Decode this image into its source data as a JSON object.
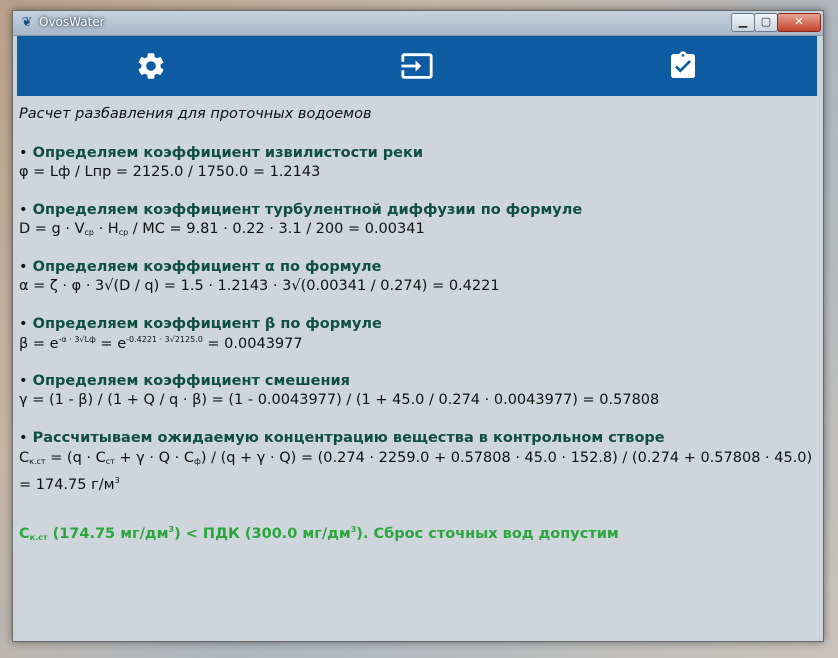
{
  "window": {
    "title": "OvosWater",
    "minimize_glyph": "▁",
    "maximize_glyph": "▢",
    "close_glyph": "✕"
  },
  "toolbar": {
    "items": [
      {
        "icon": "gear-icon"
      },
      {
        "icon": "exit-icon"
      },
      {
        "icon": "clipboard-check-icon"
      }
    ],
    "background": "#0d5ba1"
  },
  "content": {
    "title": "Расчет разбавления для проточных водоемов",
    "sections": [
      {
        "heading": "Определяем коэффициент извилистости реки",
        "formula": "φ = Lф / Lпр = 2125.0 / 1750.0 = 1.2143"
      },
      {
        "heading": "Определяем коэффициент турбулентной диффузии по формуле",
        "formula_parts": {
          "p1": "D = g · V",
          "s1": "ср",
          "p2": " · H",
          "s2": "ср",
          "p3": " / MC = 9.81 · 0.22 · 3.1 / 200 = 0.00341"
        }
      },
      {
        "heading": "Определяем коэффициент α по формуле",
        "formula": "α = ζ · φ · 3√(D / q) = 1.5 · 1.2143 · 3√(0.00341 / 0.274) = 0.4221"
      },
      {
        "heading": "Определяем коэффициент β по формуле",
        "formula_parts": {
          "p1": "β = e",
          "sup1": "-α · 3√Lф",
          "p2": " = e",
          "sup2": "-0.4221 · 3√2125.0",
          "p3": " = 0.0043977"
        }
      },
      {
        "heading": "Определяем коэффициент смешения",
        "formula": "γ = (1 - β) / (1 + Q / q · β) =  (1 - 0.0043977) / (1 + 45.0 / 0.274 · 0.0043977) = 0.57808"
      },
      {
        "heading": "Рассчитываем ожидаемую концентрацию вещества в контрольном створе",
        "formula_parts": {
          "p1": "C",
          "s1": "к.ст",
          "p2": " = (q · C",
          "s2": "ст",
          "p3": " + γ · Q · C",
          "s3": "ф",
          "p4": ") / (q + γ · Q) = (0.274 · 2259.0 + 0.57808 · 45.0 · 152.8) / (0.274 + 0.57808 · 45.0) = 174.75",
          "unit_p1": "г/м",
          "unit_sup": "3"
        }
      }
    ],
    "result_parts": {
      "p1": "C",
      "s1": "к.ст",
      "p2": " (174.75 мг/дм",
      "sup1": "3",
      "p3": ") < ПДК (300.0 мг/дм",
      "sup2": "3",
      "p4": "). Сброс сточных вод допустим"
    },
    "bullet": "•",
    "colors": {
      "heading": "#0f4f3e",
      "result": "#2aa73a"
    }
  }
}
